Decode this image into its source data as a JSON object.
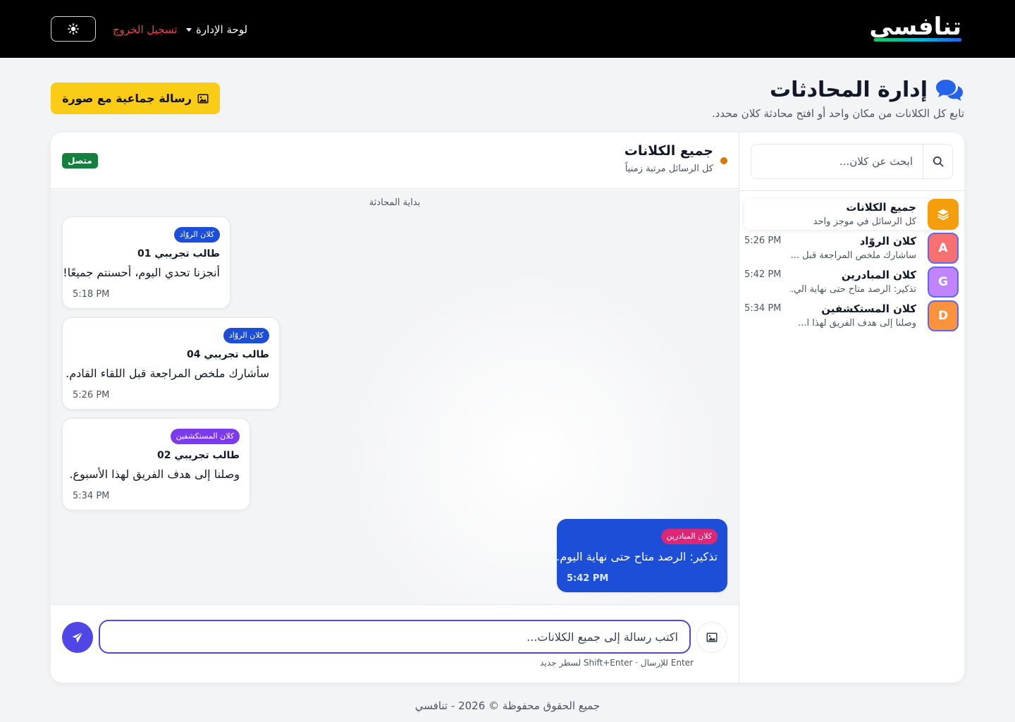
{
  "nav": {
    "logo": "تنافسي",
    "admin_label": "لوحة الإدارة",
    "logout_label": "تسجيل الخروج",
    "theme_icon": "sun-icon"
  },
  "header": {
    "title": "إدارة المحادثات",
    "subtitle": "تابع كل الكلانات من مكان واحد أو افتح محادثة كلان محدد.",
    "broadcast_label": "رسالة جماعية مع صورة"
  },
  "sidebar": {
    "search_placeholder": "ابحث عن كلان...",
    "items": [
      {
        "name": "جميع الكلانات",
        "preview": "كل الرسائل في موجز واحد",
        "time": "",
        "avatar": "",
        "color": "#f59e0b",
        "active": true
      },
      {
        "name": "كلان الروّاد",
        "preview": "سأشارك ملخص المراجعة قبل ...",
        "time": "5:26 PM",
        "avatar": "A",
        "color": "#f87171",
        "active": false
      },
      {
        "name": "كلان المبادرين",
        "preview": "تذكير: الرصد متاح حتى نهاية الي...",
        "time": "5:42 PM",
        "avatar": "G",
        "color": "#c084fc",
        "active": false
      },
      {
        "name": "كلان المستكشفين",
        "preview": "وصلنا إلى هدف الفريق لهذا ا...",
        "time": "5:34 PM",
        "avatar": "D",
        "color": "#fb923c",
        "active": false
      }
    ]
  },
  "chat": {
    "title": "جميع الكلانات",
    "subtitle": "كل الرسائل مرتبة زمنياً",
    "status": "متصل",
    "start_label": "بداية المحادثة",
    "messages": [
      {
        "tag": "كلان الروّاد",
        "tag_color": "#1d4ed8",
        "sender": "طالب تجريبي 01",
        "text": "أنجزنا تحدي اليوم، أحسنتم جميعًا!",
        "time": "5:18 PM"
      },
      {
        "tag": "كلان الروّاد",
        "tag_color": "#1d4ed8",
        "sender": "طالب تجريبي 04",
        "text": "سأشارك ملخص المراجعة قبل اللقاء القادم.",
        "time": "5:26 PM"
      },
      {
        "tag": "كلان المستكشفين",
        "tag_color": "#7c3aed",
        "sender": "طالب تجريبي 02",
        "text": "وصلنا إلى هدف الفريق لهذا الأسبوع.",
        "time": "5:34 PM"
      },
      {
        "tag": "كلان المبادرين",
        "tag_color": "#db2777",
        "sender": "",
        "text": "تذكير: الرصد متاح حتى نهاية اليوم.",
        "time": "5:42 PM"
      }
    ],
    "composer_placeholder": "اكتب رسالة إلى جميع الكلانات...",
    "hint": "Enter للإرسال · Shift+Enter لسطر جديد"
  },
  "footer": "جميع الحقوق محفوظة © 2026 - تنافسي",
  "colors": {
    "accent": "#4f46e5",
    "broadcast": "#facc15",
    "own_message": "#1d4ed8",
    "online": "#15803d"
  }
}
